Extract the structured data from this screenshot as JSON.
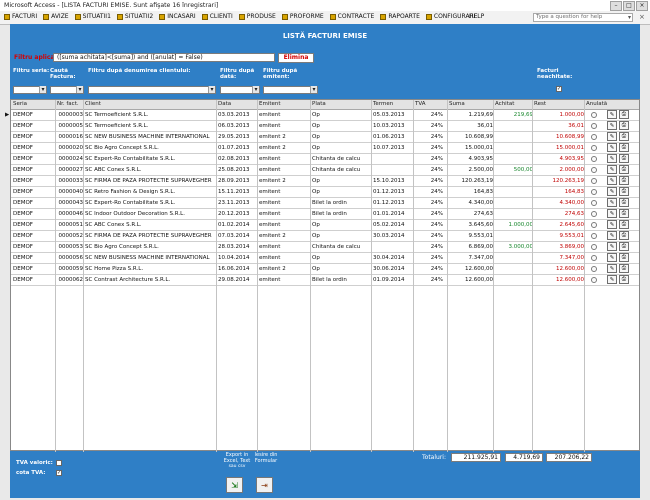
{
  "window": {
    "title": "Microsoft Access - [LISTA FACTURI EMISE. Sunt afişate 16 înregistrari]"
  },
  "menubar": {
    "items": [
      {
        "label": "FACTURI"
      },
      {
        "label": "AVIZE"
      },
      {
        "label": "SITUATII1"
      },
      {
        "label": "SITUATII2"
      },
      {
        "label": "INCASARI"
      },
      {
        "label": "CLIENTI"
      },
      {
        "label": "PRODUSE"
      },
      {
        "label": "PROFORME"
      },
      {
        "label": "CONTRACTE"
      },
      {
        "label": "RAPOARTE"
      },
      {
        "label": "CONFIGURARE"
      }
    ],
    "help": "HELP",
    "question_placeholder": "Type a question for help"
  },
  "form": {
    "title": "LISTĂ FACTURI EMISE",
    "filter_applied_label": "Filtru aplicat:",
    "filter_applied_value": "([suma achitata]<[suma]) and ([anulat] = False)",
    "elimina": "Elimina",
    "labels": {
      "filtru_seria": "Filtru seria:",
      "cauta_factura_line1": "Caută",
      "cauta_factura_line2": "Factura:",
      "filtru_client": "Filtru după denumirea clientului:",
      "filtru_data_line1": "Filtru după",
      "filtru_data_line2": "dată:",
      "filtru_emitent_line1": "Filtru după",
      "filtru_emitent_line2": "emitent:",
      "facturi_neachitate_line1": "Facturi",
      "facturi_neachitate_line2": "neachitate:"
    },
    "facturi_neachitate_checked": "✓"
  },
  "table": {
    "columns": [
      "Seria",
      "Nr. fact.",
      "Client",
      "Data",
      "Emitent",
      "Plata",
      "Termen",
      "TVA",
      "Suma",
      "Achitat",
      "Rest",
      "Anulată"
    ],
    "rows": [
      {
        "seria": "DEMOF",
        "nr": "0000003",
        "client": "SC Termoeficient S.R.L.",
        "data": "03.03.2013",
        "emitent": "emitent",
        "plata": "Op",
        "termen": "05.03.2013",
        "tva": "24%",
        "suma": "1.219,69",
        "achitat": "219,69",
        "rest": "1.000,00"
      },
      {
        "seria": "DEMOF",
        "nr": "0000005",
        "client": "SC Termoeficient S.R.L.",
        "data": "06.03.2013",
        "emitent": "emitent",
        "plata": "Op",
        "termen": "10.03.2013",
        "tva": "24%",
        "suma": "36,01",
        "achitat": "",
        "rest": "36,01"
      },
      {
        "seria": "DEMOF",
        "nr": "0000016",
        "client": "SC NEW BUSINESS MACHINE INTERNATIONAL",
        "data": "29.05.2013",
        "emitent": "emitent 2",
        "plata": "Op",
        "termen": "01.06.2013",
        "tva": "24%",
        "suma": "10.608,99",
        "achitat": "",
        "rest": "10.608,99"
      },
      {
        "seria": "DEMOF",
        "nr": "0000020",
        "client": "SC Bio Agro Concept S.R.L.",
        "data": "01.07.2013",
        "emitent": "emitent 2",
        "plata": "Op",
        "termen": "10.07.2013",
        "tva": "24%",
        "suma": "15.000,01",
        "achitat": "",
        "rest": "15.000,01"
      },
      {
        "seria": "DEMOF",
        "nr": "0000024",
        "client": "SC Expert-Ro Contabilitate S.R.L.",
        "data": "02.08.2013",
        "emitent": "emitent",
        "plata": "Chitanta de calcu",
        "termen": "",
        "tva": "24%",
        "suma": "4.903,95",
        "achitat": "",
        "rest": "4.903,95"
      },
      {
        "seria": "DEMOF",
        "nr": "0000027",
        "client": "SC ABC Conex S.R.L.",
        "data": "25.08.2013",
        "emitent": "emitent",
        "plata": "Chitanta de calcu",
        "termen": "",
        "tva": "24%",
        "suma": "2.500,00",
        "achitat": "500,00",
        "rest": "2.000,00"
      },
      {
        "seria": "DEMOF",
        "nr": "0000033",
        "client": "SC FIRMA DE PAZA PROTECTIE SUPRAVEGHER",
        "data": "28.09.2013",
        "emitent": "emitent 2",
        "plata": "Op",
        "termen": "15.10.2013",
        "tva": "24%",
        "suma": "120.263,19",
        "achitat": "",
        "rest": "120.263,19"
      },
      {
        "seria": "DEMOF",
        "nr": "0000040",
        "client": "SC Retro Fashion & Design S.R.L.",
        "data": "15.11.2013",
        "emitent": "emitent",
        "plata": "Op",
        "termen": "01.12.2013",
        "tva": "24%",
        "suma": "164,83",
        "achitat": "",
        "rest": "164,83"
      },
      {
        "seria": "DEMOF",
        "nr": "0000043",
        "client": "SC Expert-Ro Contabilitate S.R.L.",
        "data": "23.11.2013",
        "emitent": "emitent",
        "plata": "Bilet la ordin",
        "termen": "01.12.2013",
        "tva": "24%",
        "suma": "4.340,00",
        "achitat": "",
        "rest": "4.340,00"
      },
      {
        "seria": "DEMOF",
        "nr": "0000046",
        "client": "SC Indoor Outdoor Decoration S.R.L.",
        "data": "20.12.2013",
        "emitent": "emitent",
        "plata": "Bilet la ordin",
        "termen": "01.01.2014",
        "tva": "24%",
        "suma": "274,63",
        "achitat": "",
        "rest": "274,63"
      },
      {
        "seria": "DEMOF",
        "nr": "0000051",
        "client": "SC ABC Conex S.R.L.",
        "data": "01.02.2014",
        "emitent": "emitent",
        "plata": "Op",
        "termen": "05.02.2014",
        "tva": "24%",
        "suma": "3.645,60",
        "achitat": "1.000,00",
        "rest": "2.645,60"
      },
      {
        "seria": "DEMOF",
        "nr": "0000052",
        "client": "SC FIRMA DE PAZA PROTECTIE SUPRAVEGHER",
        "data": "07.03.2014",
        "emitent": "emitent 2",
        "plata": "Op",
        "termen": "30.03.2014",
        "tva": "24%",
        "suma": "9.553,01",
        "achitat": "",
        "rest": "9.553,01"
      },
      {
        "seria": "DEMOF",
        "nr": "0000053",
        "client": "SC Bio Agro Concept S.R.L.",
        "data": "28.03.2014",
        "emitent": "emitent",
        "plata": "Chitanta de calcu",
        "termen": "",
        "tva": "24%",
        "suma": "6.869,00",
        "achitat": "3.000,00",
        "rest": "3.869,00"
      },
      {
        "seria": "DEMOF",
        "nr": "0000056",
        "client": "SC NEW BUSINESS MACHINE INTERNATIONAL",
        "data": "10.04.2014",
        "emitent": "emitent",
        "plata": "Op",
        "termen": "30.04.2014",
        "tva": "24%",
        "suma": "7.347,00",
        "achitat": "",
        "rest": "7.347,00"
      },
      {
        "seria": "DEMOF",
        "nr": "0000059",
        "client": "SC Home Pizza S.R.L.",
        "data": "16.06.2014",
        "emitent": "emitent 2",
        "plata": "Op",
        "termen": "30.06.2014",
        "tva": "24%",
        "suma": "12.600,00",
        "achitat": "",
        "rest": "12.600,00"
      },
      {
        "seria": "DEMOF",
        "nr": "0000062",
        "client": "SC Contrast Architecture S.R.L.",
        "data": "29.08.2014",
        "emitent": "emitent",
        "plata": "Bilet la ordin",
        "termen": "01.09.2014",
        "tva": "24%",
        "suma": "12.600,00",
        "achitat": "",
        "rest": "12.600,00"
      }
    ]
  },
  "footer": {
    "tva_valoric": "TVA valoric:",
    "cota_tva": "cota TVA:",
    "cota_tva_checked": "✓",
    "export_line1": "Export in",
    "export_line2": "Excel, Text",
    "export_line3": "sau csv",
    "iesire_line1": "Iesire din",
    "iesire_line2": "Formular",
    "totals_label": "Totaluri:",
    "total_suma": "211.925,91",
    "total_achitat": "4.719,69",
    "total_rest": "207.206,22"
  },
  "colors": {
    "panel_blue": "#2f7fc6",
    "rest_red": "#c00000",
    "achitat_green": "#15852a",
    "filter_red": "#d40000"
  }
}
